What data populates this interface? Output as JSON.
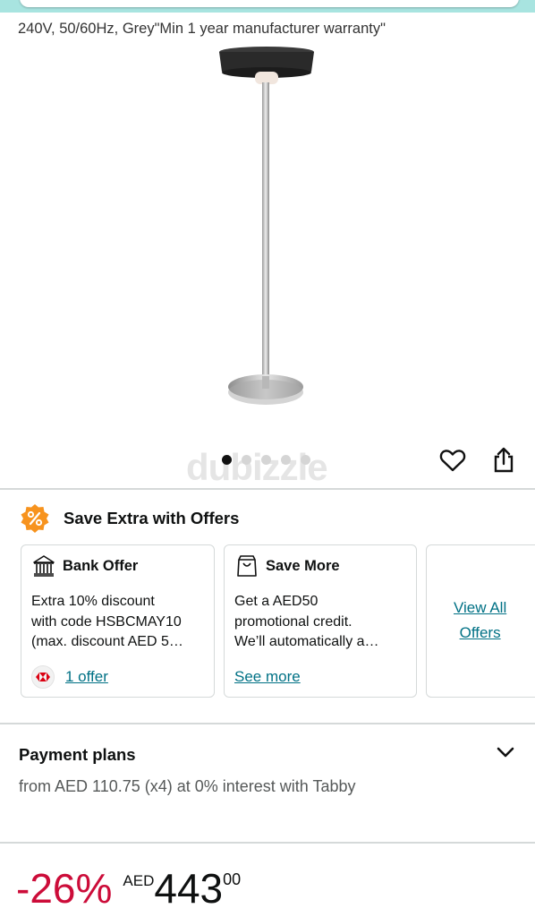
{
  "product": {
    "subtitle": "240V, 50/60Hz, Grey\"Min 1 year manufacturer warranty\"",
    "image_icon": "patio-heater-image",
    "carousel": {
      "count": 5,
      "active_index": 0
    },
    "watermark": "dubizzle",
    "actions": {
      "wishlist_icon": "heart-icon",
      "share_icon": "share-icon"
    }
  },
  "offers": {
    "title": "Save Extra with Offers",
    "badge_icon": "percent-badge-icon",
    "badge_color": "#f7931e",
    "cards": [
      {
        "icon": "bank-icon",
        "title": "Bank Offer",
        "lines": [
          "Extra 10% discount",
          "with code HSBCMAY10",
          "(max. discount AED 5…"
        ],
        "link": "1 offer"
      },
      {
        "icon": "shopping-bag-icon",
        "title": "Save More",
        "lines": [
          "Get a AED50",
          "promotional credit.",
          "We’ll automatically a…"
        ],
        "link": "See more"
      }
    ],
    "view_all": [
      "View All",
      "Offers"
    ]
  },
  "payment": {
    "title": "Payment plans",
    "description": "from AED 110.75 (x4) at 0% interest with Tabby",
    "chevron_icon": "chevron-down-icon"
  },
  "price": {
    "discount": "-26%",
    "currency": "AED",
    "whole": "443",
    "fraction": "00",
    "discount_color": "#cc0c39"
  },
  "colors": {
    "link": "#007185",
    "divider": "#d5d9d9"
  }
}
